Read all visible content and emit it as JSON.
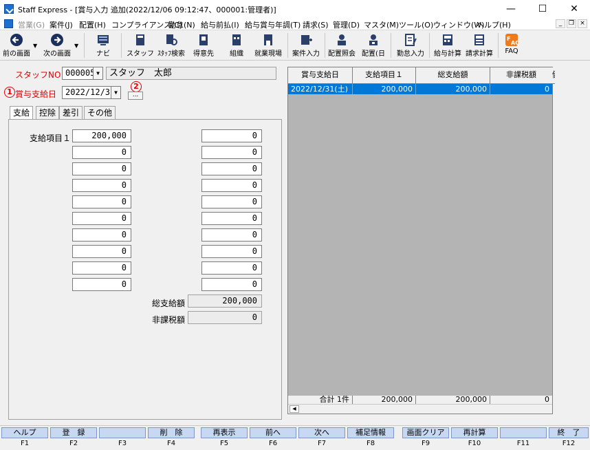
{
  "window": {
    "title": "Staff Express - [賞与入力 追加(2022/12/06 09:12:47、000001:管理者)]",
    "min": "—",
    "max": "☐",
    "close": "✕"
  },
  "menu": [
    {
      "label": "営業(G)",
      "disabled": true
    },
    {
      "label": "案件(J)"
    },
    {
      "label": "配置(H)"
    },
    {
      "label": "コンプライアンス(C)"
    },
    {
      "label": "勤怠(N)"
    },
    {
      "label": "給与前払(I)"
    },
    {
      "label": "給与賞与年調(T)"
    },
    {
      "label": "請求(S)"
    },
    {
      "label": "管理(D)"
    },
    {
      "label": "マスタ(M)"
    },
    {
      "label": "ツール(O)"
    },
    {
      "label": "ウィンドウ(W)"
    },
    {
      "label": "ヘルプ(H)"
    }
  ],
  "mdi": {
    "min": "_",
    "restore": "❐",
    "close": "×"
  },
  "toolbar": [
    {
      "label": "前の画面",
      "icon": "back-arrow-icon"
    },
    {
      "label": "次の画面",
      "icon": "forward-arrow-icon"
    },
    {
      "label": "ナビ",
      "icon": "navi-icon"
    },
    {
      "label": "スタッフ",
      "icon": "staff-icon"
    },
    {
      "label": "ｽﾀｯﾌ検索",
      "icon": "staff-search-icon"
    },
    {
      "label": "得意先",
      "icon": "customer-icon"
    },
    {
      "label": "組織",
      "icon": "organization-icon"
    },
    {
      "label": "就業現場",
      "icon": "worksite-icon"
    },
    {
      "label": "案件入力",
      "icon": "case-entry-icon"
    },
    {
      "label": "配置照会",
      "icon": "placement-inquiry-icon"
    },
    {
      "label": "配置(日",
      "icon": "placement-day-icon"
    },
    {
      "label": "勤怠入力",
      "icon": "attendance-entry-icon"
    },
    {
      "label": "給与計算",
      "icon": "payroll-calc-icon"
    },
    {
      "label": "請求計算",
      "icon": "billing-calc-icon"
    },
    {
      "label": "FAQ",
      "icon": "faq-icon"
    }
  ],
  "form": {
    "staff_no_label": "スタッフNO",
    "staff_no_value": "000005",
    "staff_name": "スタッフ　太郎",
    "marker1": "1",
    "bonus_date_label": "賞与支給日",
    "bonus_date_value": "2022/12/31",
    "marker2": "2",
    "ellipsis": "..."
  },
  "tabs": [
    "支給",
    "控除",
    "差引",
    "その他"
  ],
  "payments": {
    "first_label": "支給項目１",
    "left": [
      "200,000",
      "0",
      "0",
      "0",
      "0",
      "0",
      "0",
      "0",
      "0",
      "0"
    ],
    "right": [
      "0",
      "0",
      "0",
      "0",
      "0",
      "0",
      "0",
      "0",
      "0",
      "0"
    ],
    "total_label": "総支給額",
    "total_value": "200,000",
    "nontax_label": "非課税額",
    "nontax_value": "0"
  },
  "grid": {
    "headers": [
      "賞与支給日",
      "支給項目１",
      "総支給額",
      "非課税額",
      "健康"
    ],
    "rows": [
      [
        "2022/12/31(土)",
        "200,000",
        "200,000",
        "0"
      ]
    ],
    "footer": [
      "合計 1件",
      "200,000",
      "200,000",
      "0"
    ]
  },
  "fkeys": [
    {
      "label": "ヘルプ",
      "key": "F1"
    },
    {
      "label": "登　録",
      "key": "F2"
    },
    {
      "label": "",
      "key": "F3"
    },
    {
      "label": "削　除",
      "key": "F4"
    },
    {
      "label": "再表示",
      "key": "F5"
    },
    {
      "label": "前へ",
      "key": "F6"
    },
    {
      "label": "次へ",
      "key": "F7"
    },
    {
      "label": "補足情報",
      "key": "F8"
    },
    {
      "label": "画面クリア",
      "key": "F9"
    },
    {
      "label": "再計算",
      "key": "F10"
    },
    {
      "label": "",
      "key": "F11"
    },
    {
      "label": "終　了",
      "key": "F12"
    }
  ],
  "colors": {
    "accent": "#0078d7",
    "marker": "#e00000",
    "fkey": "#c9d8f2"
  }
}
